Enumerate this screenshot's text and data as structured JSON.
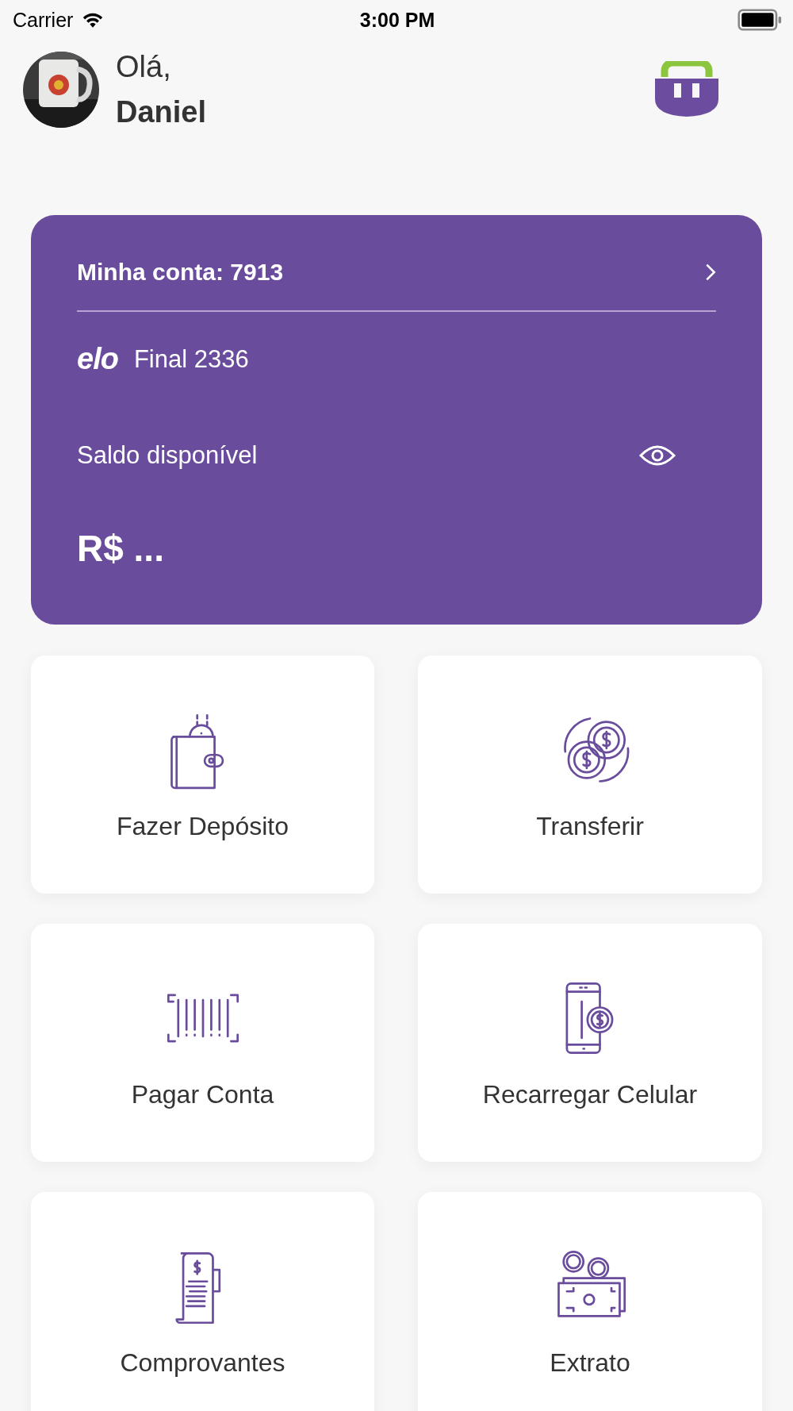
{
  "status_bar": {
    "carrier": "Carrier",
    "time": "3:00 PM"
  },
  "header": {
    "greeting": "Olá,",
    "name": "Daniel"
  },
  "account_card": {
    "title": "Minha conta: 7913",
    "card_brand": "elo",
    "card_number": "Final 2336",
    "balance_label": "Saldo disponível",
    "balance": "R$ ...",
    "balance_hidden": true
  },
  "actions": [
    {
      "label": "Fazer Depósito"
    },
    {
      "label": "Transferir"
    },
    {
      "label": "Pagar Conta"
    },
    {
      "label": "Recarregar Celular"
    },
    {
      "label": "Comprovantes"
    },
    {
      "label": "Extrato"
    }
  ]
}
